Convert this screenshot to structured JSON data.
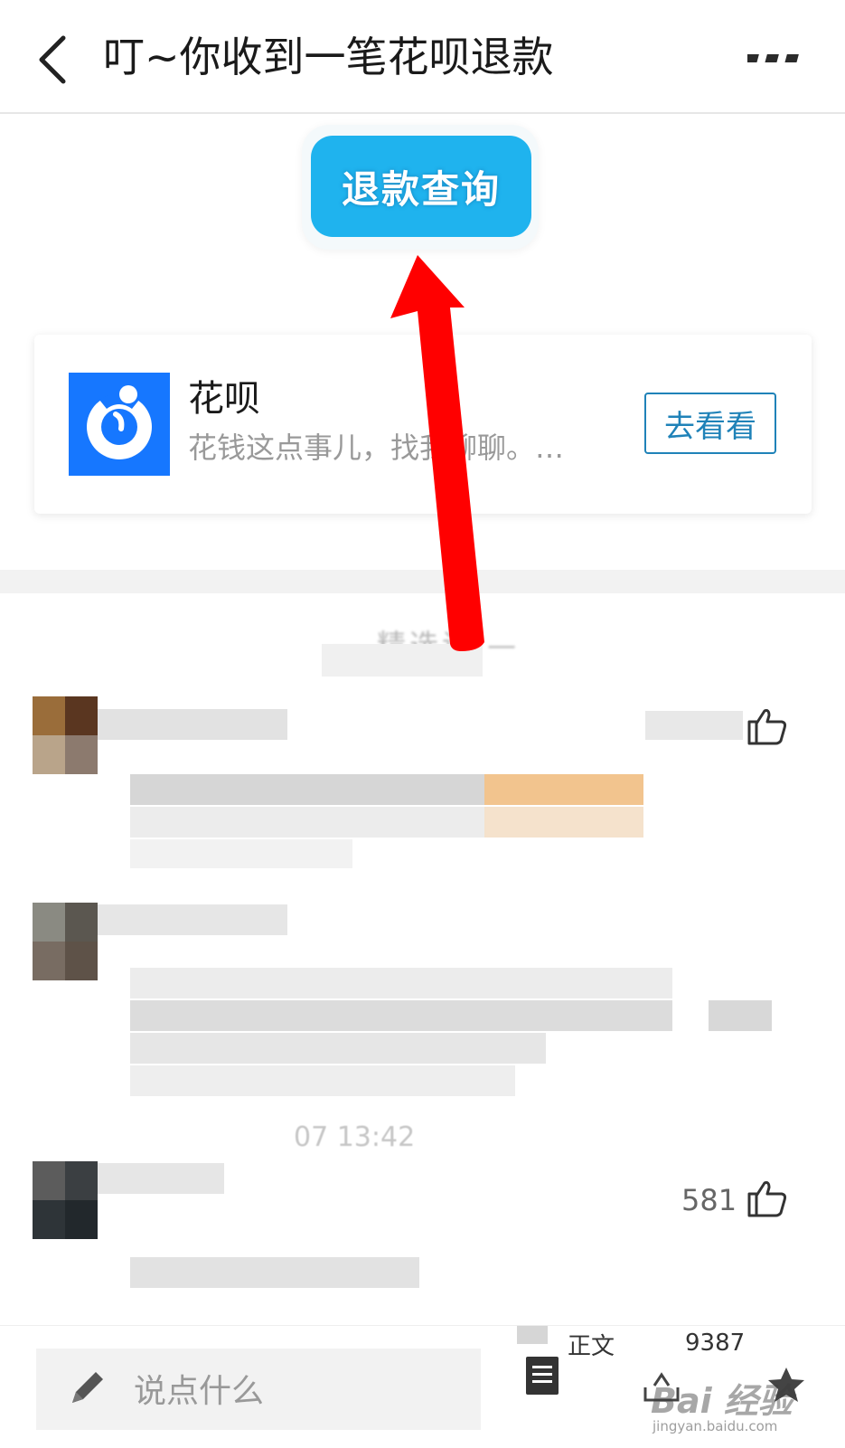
{
  "header": {
    "title": "叮~你收到一笔花呗退款",
    "back_icon": "chevron-left-icon",
    "more_icon": "more-dots-icon"
  },
  "refund_button": {
    "label": "退款查询",
    "color": "#1fb3ee"
  },
  "mini_program_card": {
    "logo_icon": "huabei-logo-icon",
    "logo_color": "#1677ff",
    "name": "花呗",
    "description": "花钱这点事儿，找我聊聊。…",
    "action_label": "去看看"
  },
  "comments_section": {
    "title": "— 精选评 —",
    "comments": [
      {
        "like_count": ""
      },
      {
        "time": "07 13:42"
      },
      {
        "like_count": "581"
      }
    ]
  },
  "bottom_bar": {
    "comment_placeholder": "说点什么",
    "article_label": "正文",
    "share_count": "9387"
  },
  "watermark": {
    "text": "Bai 经验",
    "url": "jingyan.baidu.com"
  },
  "annotation": {
    "arrow_color": "#ff0000"
  }
}
